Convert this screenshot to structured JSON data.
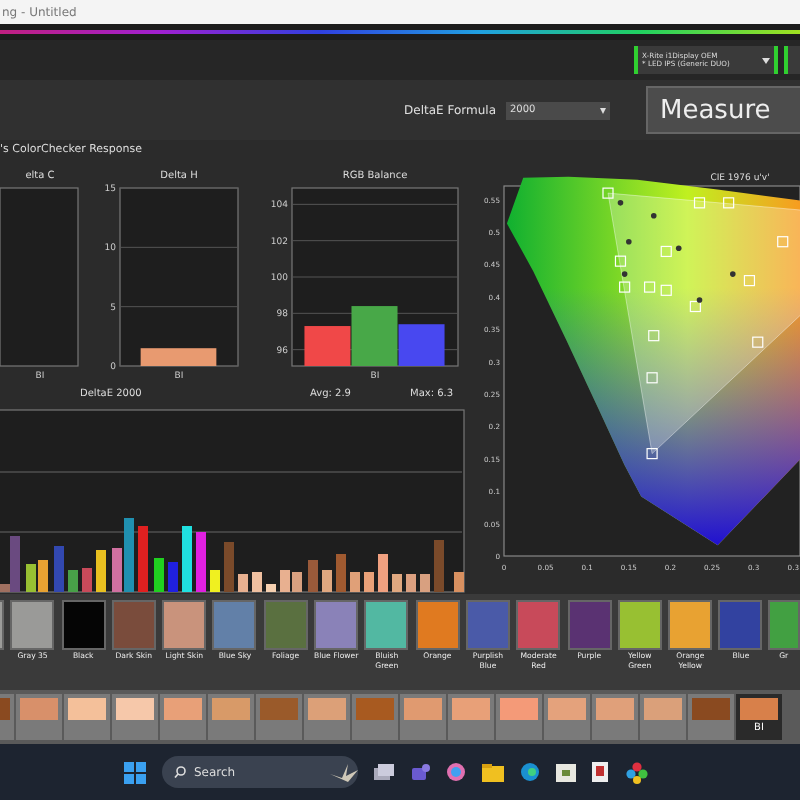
{
  "window": {
    "title": "ng - Untitled"
  },
  "toolbar": {
    "device": {
      "line_1": "X-Rite i1Display OEM",
      "line_2": "* LED IPS (Generic DUO)"
    }
  },
  "deltae_formula": {
    "label": "DeltaE Formula",
    "value": "2000"
  },
  "measure_button": "Measure",
  "section_title": "'s ColorChecker Response",
  "delta_c": {
    "title": "elta C",
    "category": "BI"
  },
  "charts": [
    {
      "chart_data": {
        "type": "bar",
        "title": "Delta H",
        "categories": [
          "BI"
        ],
        "values": [
          1.5
        ],
        "ylim": [
          0,
          15
        ],
        "yticks": [
          0,
          5,
          10,
          15
        ],
        "grid": true
      }
    },
    {
      "bars": [
        {
          "color": "#f04848"
        },
        {
          "color": "#48a848"
        },
        {
          "color": "#4848f0"
        }
      ],
      "chart_data": {
        "type": "bar",
        "title": "RGB Balance",
        "categories": [
          null,
          "BI",
          null
        ],
        "values": [
          97.3,
          98.4,
          97.4
        ],
        "ylim": [
          95.1,
          104.9
        ],
        "yticks": [
          96,
          98,
          100,
          102,
          104
        ],
        "grid": true
      }
    }
  ],
  "deltae": {
    "title": "DeltaE 2000",
    "avg": "Avg: 2.9",
    "max": "Max: 6.3"
  },
  "cie": {
    "title": "CIE 1976 u'v'",
    "x_ticks": [
      "0",
      "0.05",
      "0.1",
      "0.15",
      "0.2",
      "0.25",
      "0.3",
      "0.3"
    ],
    "y_ticks": [
      "0.55",
      "0.5",
      "0.45",
      "0.4",
      "0.35",
      "0.3",
      "0.25",
      "0.2",
      "0.15",
      "0.1",
      "0.05",
      "0"
    ]
  },
  "patches": [
    {
      "color": "#9c9c9a",
      "selected": false
    },
    {
      "label": "Gray 35",
      "color": "#9a9a98",
      "selected": false
    },
    {
      "label": "Black",
      "color": "#050505",
      "selected": false
    },
    {
      "label": "Dark Skin",
      "color": "#7a4c3c",
      "selected": false
    },
    {
      "label": "Light Skin",
      "color": "#c9937c",
      "selected": false
    },
    {
      "label": "Blue Sky",
      "color": "#6280a8",
      "selected": false
    },
    {
      "label": "Foliage",
      "color": "#5a7040",
      "selected": false
    },
    {
      "label": "Blue Flower",
      "color": "#8a82b8",
      "selected": false
    },
    {
      "label": "Bluish Green",
      "color": "#52b8a2",
      "selected": false
    },
    {
      "label": "Orange",
      "color": "#e07a20",
      "selected": false
    },
    {
      "label": "Purplish Blue",
      "color": "#4a5aa8",
      "selected": false
    },
    {
      "label": "Moderate Red",
      "color": "#c84a5a",
      "selected": false
    },
    {
      "label": "Purple",
      "color": "#5a3272",
      "selected": false
    },
    {
      "label": "Yellow Green",
      "color": "#98c032",
      "selected": false
    },
    {
      "label": "Orange Yellow",
      "color": "#e8a232",
      "selected": false
    },
    {
      "label": "Blue",
      "color": "#3242a0",
      "selected": false
    },
    {
      "label": "Gr",
      "color": "#42a042",
      "selected": false
    }
  ],
  "skin_patches": [
    {
      "color": "#8a4a20",
      "selected": false
    },
    {
      "color": "#d8906a",
      "selected": false
    },
    {
      "color": "#f4c09a",
      "selected": false
    },
    {
      "color": "#f6c8aa",
      "selected": false
    },
    {
      "color": "#e8a078",
      "selected": false
    },
    {
      "color": "#d89a68",
      "selected": false
    },
    {
      "color": "#9a5a2a",
      "selected": false
    },
    {
      "color": "#dca078",
      "selected": false
    },
    {
      "color": "#a85a20",
      "selected": false
    },
    {
      "color": "#e09a70",
      "selected": false
    },
    {
      "color": "#e8a078",
      "selected": false
    },
    {
      "color": "#f49a78",
      "selected": false
    },
    {
      "color": "#e4a27c",
      "selected": false
    },
    {
      "color": "#e0a07a",
      "selected": false
    },
    {
      "color": "#daa07a",
      "selected": false
    },
    {
      "color": "#8a4a20",
      "selected": false
    },
    {
      "color": "#d8804a",
      "selected": true,
      "label": "BI"
    }
  ],
  "taskbar": {
    "search": {
      "placeholder": "Search"
    }
  }
}
